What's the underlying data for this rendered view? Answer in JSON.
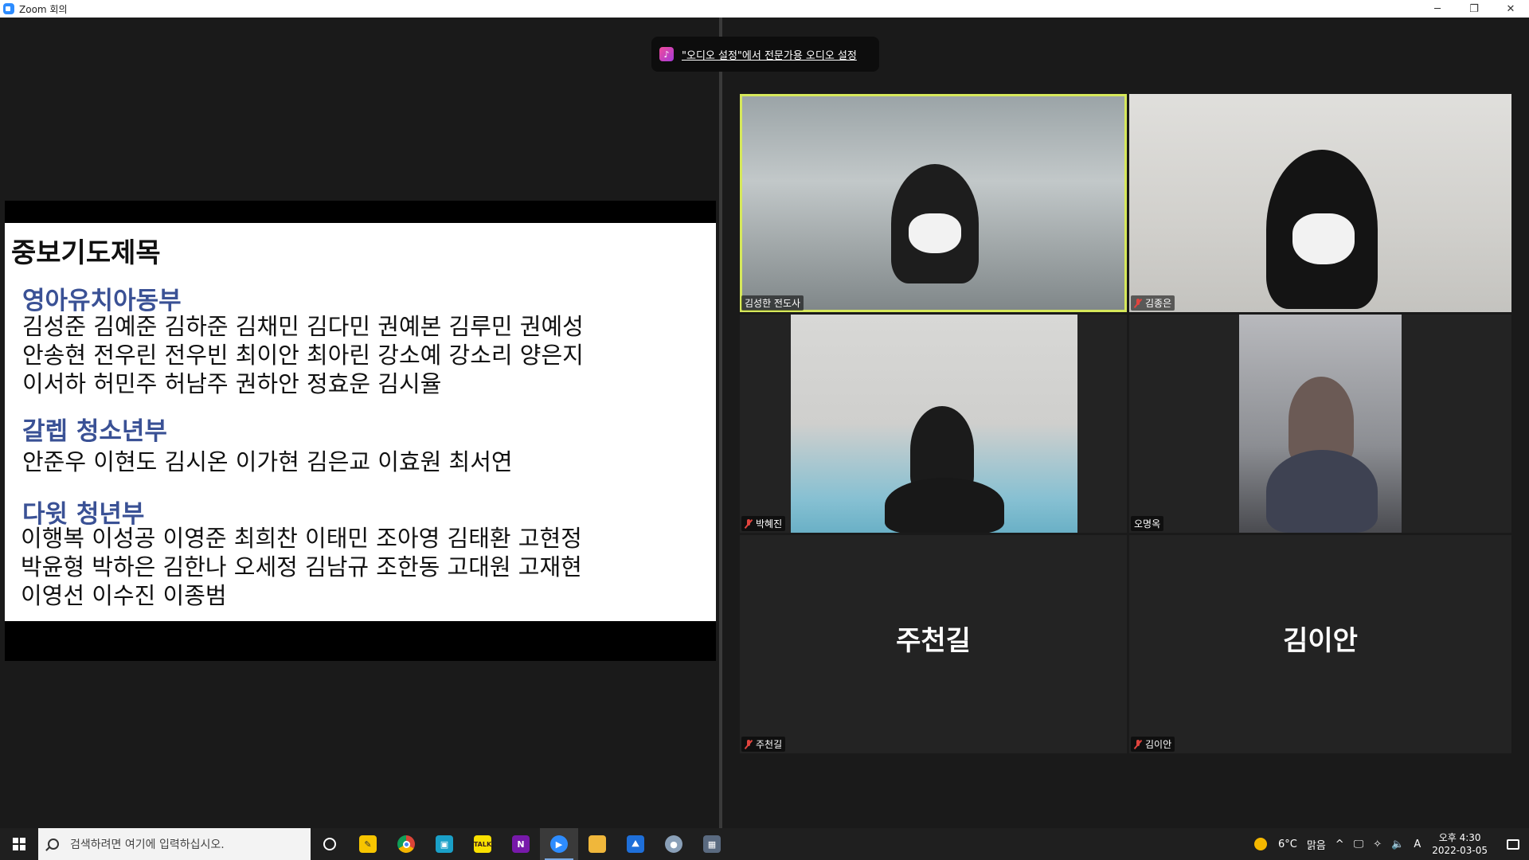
{
  "window": {
    "title": "Zoom 회의",
    "controls": {
      "minimize": "─",
      "restore": "❐",
      "close": "✕"
    }
  },
  "notice": {
    "text": "\"오디오 설정\"에서 전문가용 오디오 설정"
  },
  "slide": {
    "title": "중보기도제목",
    "sections": [
      {
        "heading": "영아유치아동부",
        "lines": [
          "김성준 김예준 김하준 김채민 김다민 권예본 김루민 권예성",
          "안송현 전우린 전우빈 최이안 최아린 강소예 강소리 양은지",
          "이서하 허민주 허남주 권하안 정효운 김시율"
        ]
      },
      {
        "heading": "갈렙 청소년부",
        "lines": [
          "안준우 이현도 김시온 이가현 김은교 이효원 최서연"
        ]
      },
      {
        "heading": "다윗 청년부",
        "lines": [
          "이행복 이성공 이영준 최희찬 이태민 조아영 김태환 고현정",
          "박윤형 박하은 김한나 오세정 김남규 조한동 고대원 고재현",
          "이영선 이수진 이종범"
        ]
      }
    ]
  },
  "participants": [
    {
      "name": "김성한 전도사",
      "muted": false,
      "video": true
    },
    {
      "name": "김종은",
      "muted": true,
      "video": true
    },
    {
      "name": "박혜진",
      "muted": true,
      "video": true
    },
    {
      "name": "오명옥",
      "muted": false,
      "video": true
    },
    {
      "name": "주천길",
      "muted": true,
      "video": false,
      "display": "주천길"
    },
    {
      "name": "김이안",
      "muted": true,
      "video": false,
      "display": "김이안"
    }
  ],
  "taskbar": {
    "search_placeholder": "검색하려면 여기에 입력하십시오.",
    "apps": [
      "task-view",
      "sticky-notes",
      "chrome",
      "calendar",
      "kakaotalk",
      "onenote",
      "zoom",
      "file-explorer",
      "photos",
      "paint",
      "calculator"
    ],
    "weather": {
      "temp": "6°C",
      "condition": "맑음"
    },
    "ime": "A",
    "time": "오후 4:30",
    "date": "2022-03-05"
  }
}
